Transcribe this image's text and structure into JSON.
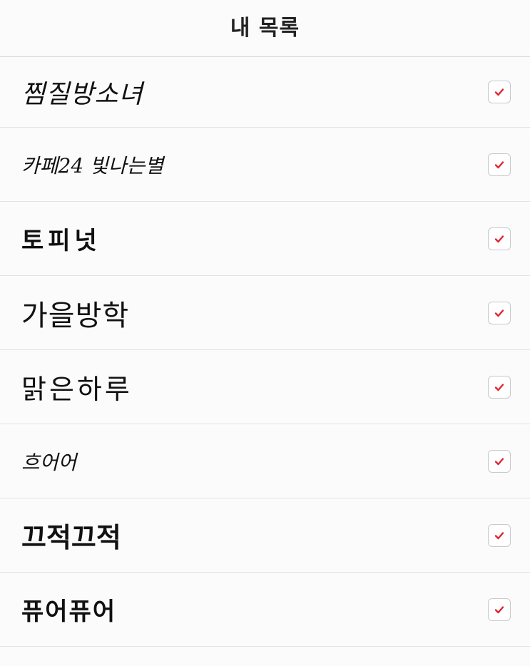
{
  "header": {
    "title": "내 목록"
  },
  "colors": {
    "check_mark": "#e0262f",
    "checkbox_border": "#c9c9c9",
    "background": "#fbfbfb",
    "divider": "#e2e2e2"
  },
  "font_list": [
    {
      "name": "찜질방소녀",
      "checked": true,
      "icon": "checkmark-icon"
    },
    {
      "name": "카페24 빛나는별",
      "checked": true,
      "icon": "checkmark-icon"
    },
    {
      "name": "토피넛",
      "checked": true,
      "icon": "checkmark-icon"
    },
    {
      "name": "가을방학",
      "checked": true,
      "icon": "checkmark-icon"
    },
    {
      "name": "맑은하루",
      "checked": true,
      "icon": "checkmark-icon"
    },
    {
      "name": "흐어어",
      "checked": true,
      "icon": "checkmark-icon"
    },
    {
      "name": "끄적끄적",
      "checked": true,
      "icon": "checkmark-icon"
    },
    {
      "name": "퓨어퓨어",
      "checked": true,
      "icon": "checkmark-icon"
    }
  ]
}
